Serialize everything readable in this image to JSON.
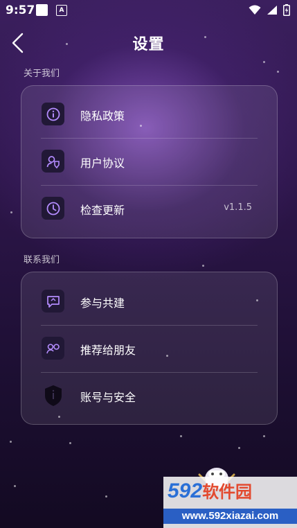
{
  "status_bar": {
    "time": "9:57",
    "a_icon": "A"
  },
  "header": {
    "title": "设置"
  },
  "about": {
    "section_label": "关于我们",
    "items": [
      {
        "label": "隐私政策",
        "icon": "info-icon"
      },
      {
        "label": "用户协议",
        "icon": "user-agreement-icon"
      },
      {
        "label": "检查更新",
        "icon": "clock-icon",
        "value": "v1.1.5"
      }
    ]
  },
  "contact": {
    "section_label": "联系我们",
    "items": [
      {
        "label": "参与共建",
        "icon": "feedback-icon"
      },
      {
        "label": "推荐给朋友",
        "icon": "share-friends-icon"
      },
      {
        "label": "账号与安全",
        "icon": "shield-icon"
      }
    ]
  },
  "watermark": {
    "brand_num": "592",
    "brand_cn": "软件园",
    "url": "www.592xiazai.com"
  },
  "colors": {
    "accent": "#b48cff",
    "icon_bg": "#211836"
  }
}
